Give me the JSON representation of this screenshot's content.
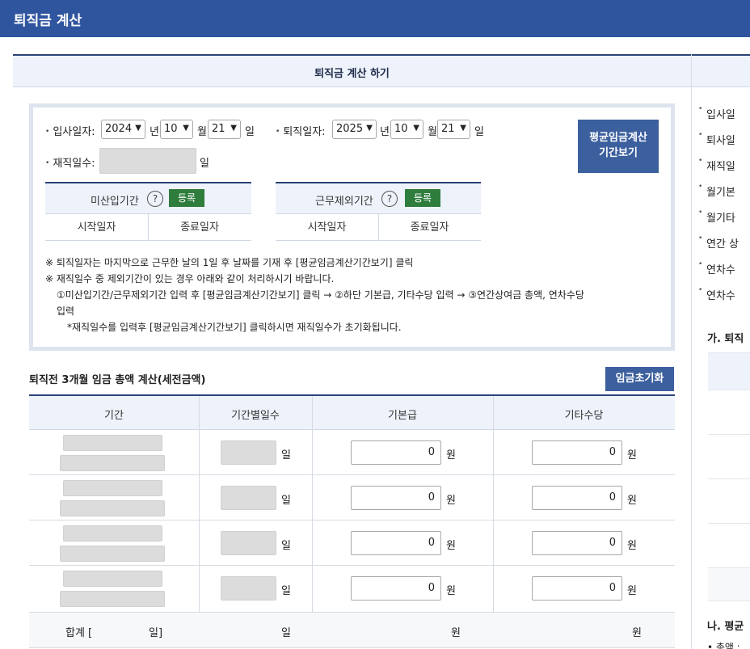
{
  "header": {
    "title": "퇴직금 계산"
  },
  "section": {
    "title": "퇴직금 계산 하기"
  },
  "form": {
    "join_label": "입사일자:",
    "join_year": "2024",
    "join_month": "10",
    "join_day": "21",
    "leave_label": "퇴직일자:",
    "leave_year": "2025",
    "leave_month": "10",
    "leave_day": "21",
    "unit_year": "년",
    "unit_month": "월",
    "unit_day": "일",
    "tenure_label": "재직일수:",
    "tenure_unit": "일",
    "period_button_line1": "평균임금계산",
    "period_button_line2": "기간보기"
  },
  "unpaid_period": {
    "title": "미산입기간",
    "help": "?",
    "register": "등록",
    "start": "시작일자",
    "end": "종료일자"
  },
  "excluded_period": {
    "title": "근무제외기간",
    "help": "?",
    "register": "등록",
    "start": "시작일자",
    "end": "종료일자"
  },
  "notes": {
    "n1": "※ 퇴직일자는 마지막으로 근무한 날의 1일 후 날짜를 기재 후 [평균임금계산기간보기] 클릭",
    "n2": "※ 재직일수 중 제외기간이 있는 경우 아래와 같이 처리하시기 바랍니다.",
    "n3": "①미산입기간/근무제외기간 입력 후 [평균임금계산기간보기] 클릭 → ②하단 기본급, 기타수당 입력 → ③연간상여금 총액, 연차수당",
    "n3b": "입력",
    "n4": "*재직일수를 입력후 [평균임금계산기간보기] 클릭하시면 재직일수가 초기화됩니다."
  },
  "wage_section": {
    "title": "퇴직전 3개월 임금 총액 계산(세전금액)",
    "reset_button": "임금초기화"
  },
  "wage_table": {
    "headers": [
      "기간",
      "기간별일수",
      "기본급",
      "기타수당"
    ],
    "rows": [
      {
        "days_unit": "일",
        "basic": "0",
        "basic_unit": "원",
        "other": "0",
        "other_unit": "원"
      },
      {
        "days_unit": "일",
        "basic": "0",
        "basic_unit": "원",
        "other": "0",
        "other_unit": "원"
      },
      {
        "days_unit": "일",
        "basic": "0",
        "basic_unit": "원",
        "other": "0",
        "other_unit": "원"
      },
      {
        "days_unit": "일",
        "basic": "0",
        "basic_unit": "원",
        "other": "0",
        "other_unit": "원"
      }
    ],
    "total_label": "합계 [",
    "total_label_end": "일]",
    "total_days_unit": "일",
    "total_basic_unit": "원",
    "total_other_unit": "원"
  },
  "right_panel": {
    "items": [
      "입사일",
      "퇴사일",
      "재직일",
      "월기본",
      "월기타",
      "연간 상",
      "연차수",
      "연차수"
    ],
    "sub1": "가. 퇴직",
    "sub2": "나. 평균",
    "sub2_line": "• 총액 : "
  }
}
